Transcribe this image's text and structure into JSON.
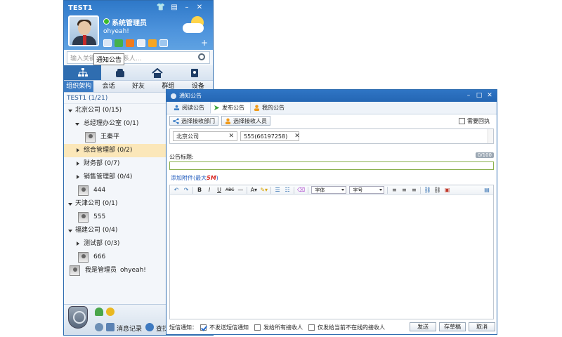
{
  "main_window": {
    "title": "TEST1",
    "user_name": "系统管理员",
    "signature": "ohyeah!",
    "search_placeholder": "输入关键字,查找联系人...",
    "tooltip": "通知公告",
    "subtabs": [
      "组织架构",
      "会话",
      "好友",
      "群组",
      "设备"
    ],
    "group_header": "TEST1 (1/21)",
    "tree": [
      {
        "label": "北京公司 (0/15)",
        "kind": "folder",
        "expanded": true
      },
      {
        "label": "总经理办公室 (0/1)",
        "kind": "folder",
        "expanded": true
      },
      {
        "label": "王秦平",
        "kind": "person"
      },
      {
        "label": "综合管理部 (0/2)",
        "kind": "folder",
        "expanded": false,
        "selected": true
      },
      {
        "label": "财务部 (0/7)",
        "kind": "folder",
        "expanded": false
      },
      {
        "label": "销售管理部 (0/4)",
        "kind": "folder",
        "expanded": false
      },
      {
        "label": "444",
        "kind": "person"
      },
      {
        "label": "天津公司 (0/1)",
        "kind": "folder",
        "expanded": true
      },
      {
        "label": "555",
        "kind": "person"
      },
      {
        "label": "福建公司 (0/4)",
        "kind": "folder",
        "expanded": true
      },
      {
        "label": "测试部 (0/3)",
        "kind": "folder",
        "expanded": false
      },
      {
        "label": "666",
        "kind": "person"
      },
      {
        "label": "我是管理员",
        "kind": "person",
        "note": "ohyeah!"
      }
    ],
    "bottom": {
      "msg_record": "消息记录",
      "search": "查找"
    }
  },
  "dialog": {
    "title": "通知公告",
    "tabs": [
      "阅读公告",
      "发布公告",
      "我的公告"
    ],
    "select_dept": "选择接收部门",
    "select_person": "选择接收人员",
    "need_receipt": "需要回执",
    "recipients": [
      "北京公司",
      "555(66197258)"
    ],
    "title_label": "公告标题:",
    "counter": "0/100",
    "attach_text": "添加附件(最大",
    "attach_size": "5M",
    "attach_close": ")",
    "font_dd": "字体",
    "size_dd": "字号",
    "sms_label": "短信通知：",
    "sms_opt1": "不发送短信通知",
    "sms_opt2": "发给所有接收人",
    "sms_opt3": "仅发给当前不在线的接收人",
    "btn_send": "发送",
    "btn_draft": "存草稿",
    "btn_cancel": "取消"
  },
  "colors": {
    "accent": "#2f6db0",
    "selected_row": "#fbe7b9",
    "title_border": "#8ab14f"
  }
}
